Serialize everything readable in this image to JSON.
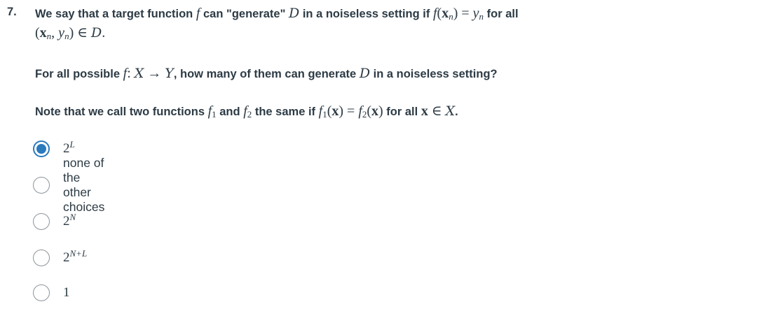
{
  "question": {
    "number": "7.",
    "p1_a": "We say that a target function ",
    "p1_f": "f",
    "p1_b": " can \"generate\" ",
    "p1_D": "D",
    "p1_c": " in a noiseless setting if ",
    "p1_eq_f": "f",
    "p1_eq_x": "x",
    "p1_eq_n1": "n",
    "p1_eq_y": "y",
    "p1_eq_n2": "n",
    "p1_d": " for all",
    "p1_pair_x": "x",
    "p1_pair_n1": "n",
    "p1_pair_y": "y",
    "p1_pair_n2": "n",
    "p1_pair_D": "D",
    "p2_a": "For all possible ",
    "p2_f": "f",
    "p2_X": "X",
    "p2_Y": "Y",
    "p2_b": ", how many of them can generate ",
    "p2_D": "D",
    "p2_c": " in a noiseless setting?",
    "p3_a": "Note that we call two functions ",
    "p3_f1": "f",
    "p3_f1_sub": "1",
    "p3_b": " and ",
    "p3_f2": "f",
    "p3_f2_sub": "2",
    "p3_c": " the same if ",
    "p3_e1_f": "f",
    "p3_e1_sub": "1",
    "p3_e1_x": "x",
    "p3_e2_f": "f",
    "p3_e2_sub": "2",
    "p3_e2_x": "x",
    "p3_d": " for all ",
    "p3_x": "x",
    "p3_X": "X",
    "p3_e": "."
  },
  "answers": [
    {
      "base": "2",
      "exp": "L",
      "selected": true
    },
    {
      "text": "none of the other choices",
      "selected": false
    },
    {
      "base": "2",
      "exp": "N",
      "selected": false
    },
    {
      "base": "2",
      "exp": "N+L",
      "selected": false
    },
    {
      "base": "1",
      "exp": "",
      "selected": false
    }
  ],
  "colors": {
    "text": "#2d3b45",
    "accent": "#2b7abc",
    "radio_border": "#8b949b"
  }
}
